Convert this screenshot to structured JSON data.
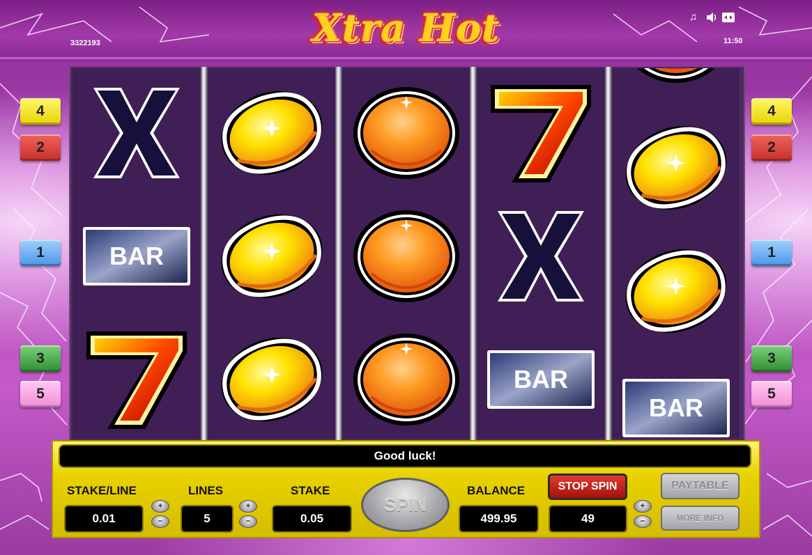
{
  "header": {
    "logo_text": "Xtra Hot",
    "session_id": "3322193",
    "clock": "11:50",
    "icons": [
      "music-note-icon",
      "speaker-icon",
      "fullscreen-icon"
    ]
  },
  "line_markers": {
    "left": [
      {
        "label": "4",
        "color": "yellow"
      },
      {
        "label": "2",
        "color": "red"
      },
      {
        "label": "1",
        "color": "blue"
      },
      {
        "label": "3",
        "color": "green"
      },
      {
        "label": "5",
        "color": "pink"
      }
    ],
    "right": [
      {
        "label": "4",
        "color": "yellow"
      },
      {
        "label": "2",
        "color": "red"
      },
      {
        "label": "1",
        "color": "blue"
      },
      {
        "label": "3",
        "color": "green"
      },
      {
        "label": "5",
        "color": "pink"
      }
    ]
  },
  "reels": [
    [
      "x",
      "bar",
      "seven"
    ],
    [
      "lemon",
      "lemon",
      "lemon"
    ],
    [
      "orange",
      "orange",
      "orange"
    ],
    [
      "seven",
      "x",
      "bar"
    ],
    [
      "orange-partial",
      "lemon",
      "lemon",
      "bar"
    ]
  ],
  "symbol_text": {
    "bar": "BAR",
    "x": "X",
    "seven": "7"
  },
  "message": "Good luck!",
  "controls": {
    "stake_per_line": {
      "label": "STAKE/LINE",
      "value": "0.01"
    },
    "lines": {
      "label": "LINES",
      "value": "5"
    },
    "stake": {
      "label": "STAKE",
      "value": "0.05"
    },
    "spin_label": "SPIN",
    "balance": {
      "label": "BALANCE",
      "value": "499.95"
    },
    "stop_spin_label": "STOP SPIN",
    "autoplay_value": "49",
    "paytable_label": "PAYTABLE",
    "more_info_label": "MORE INFO",
    "stepper_up": "+",
    "stepper_down": "−"
  },
  "colors": {
    "reel_bg": "#3f1f55",
    "panel_yellow": "#e8d200",
    "stop_spin_red": "#c2231b",
    "background_purple": "#a83ab0"
  }
}
